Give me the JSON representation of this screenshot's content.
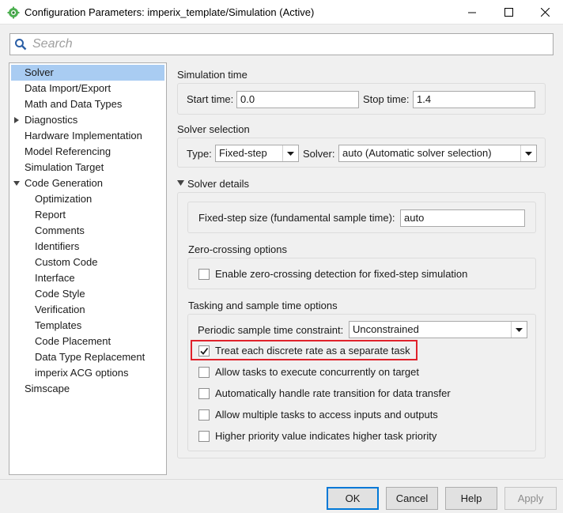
{
  "window": {
    "title": "Configuration Parameters: imperix_template/Simulation (Active)",
    "icon": "simulink-gear-icon"
  },
  "search": {
    "placeholder": "Search"
  },
  "tree": {
    "items": [
      {
        "label": "Solver",
        "level": 0,
        "selected": true,
        "arrow": ""
      },
      {
        "label": "Data Import/Export",
        "level": 0,
        "arrow": ""
      },
      {
        "label": "Math and Data Types",
        "level": 0,
        "arrow": ""
      },
      {
        "label": "Diagnostics",
        "level": 0,
        "arrow": "collapsed"
      },
      {
        "label": "Hardware Implementation",
        "level": 0,
        "arrow": ""
      },
      {
        "label": "Model Referencing",
        "level": 0,
        "arrow": ""
      },
      {
        "label": "Simulation Target",
        "level": 0,
        "arrow": ""
      },
      {
        "label": "Code Generation",
        "level": 0,
        "arrow": "expanded"
      },
      {
        "label": "Optimization",
        "level": 1,
        "arrow": ""
      },
      {
        "label": "Report",
        "level": 1,
        "arrow": ""
      },
      {
        "label": "Comments",
        "level": 1,
        "arrow": ""
      },
      {
        "label": "Identifiers",
        "level": 1,
        "arrow": ""
      },
      {
        "label": "Custom Code",
        "level": 1,
        "arrow": ""
      },
      {
        "label": "Interface",
        "level": 1,
        "arrow": ""
      },
      {
        "label": "Code Style",
        "level": 1,
        "arrow": ""
      },
      {
        "label": "Verification",
        "level": 1,
        "arrow": ""
      },
      {
        "label": "Templates",
        "level": 1,
        "arrow": ""
      },
      {
        "label": "Code Placement",
        "level": 1,
        "arrow": ""
      },
      {
        "label": "Data Type Replacement",
        "level": 1,
        "arrow": ""
      },
      {
        "label": "imperix ACG options",
        "level": 1,
        "arrow": ""
      },
      {
        "label": "Simscape",
        "level": 0,
        "arrow": ""
      }
    ]
  },
  "simulation_time": {
    "heading": "Simulation time",
    "start_label": "Start time:",
    "start_value": "0.0",
    "stop_label": "Stop time:",
    "stop_value": "1.4"
  },
  "solver_selection": {
    "heading": "Solver selection",
    "type_label": "Type:",
    "type_value": "Fixed-step",
    "solver_label": "Solver:",
    "solver_value": "auto (Automatic solver selection)"
  },
  "solver_details": {
    "heading": "Solver details",
    "step_label": "Fixed-step size (fundamental sample time):",
    "step_value": "auto"
  },
  "zero_crossing": {
    "heading": "Zero-crossing options",
    "enable_label": "Enable zero-crossing detection for fixed-step simulation",
    "enable_checked": false
  },
  "tasking": {
    "heading": "Tasking and sample time options",
    "constraint_label": "Periodic sample time constraint:",
    "constraint_value": "Unconstrained",
    "options": [
      {
        "label": "Treat each discrete rate as a separate task",
        "checked": true
      },
      {
        "label": "Allow tasks to execute concurrently on target",
        "checked": false
      },
      {
        "label": "Automatically handle rate transition for data transfer",
        "checked": false
      },
      {
        "label": "Allow multiple tasks to access inputs and outputs",
        "checked": false
      },
      {
        "label": "Higher priority value indicates higher task priority",
        "checked": false
      }
    ],
    "highlight_color": "#e0222b"
  },
  "buttons": {
    "ok": "OK",
    "cancel": "Cancel",
    "help": "Help",
    "apply": "Apply"
  },
  "colors": {
    "selection": "#a9ccf2",
    "accent": "#0078d7"
  }
}
